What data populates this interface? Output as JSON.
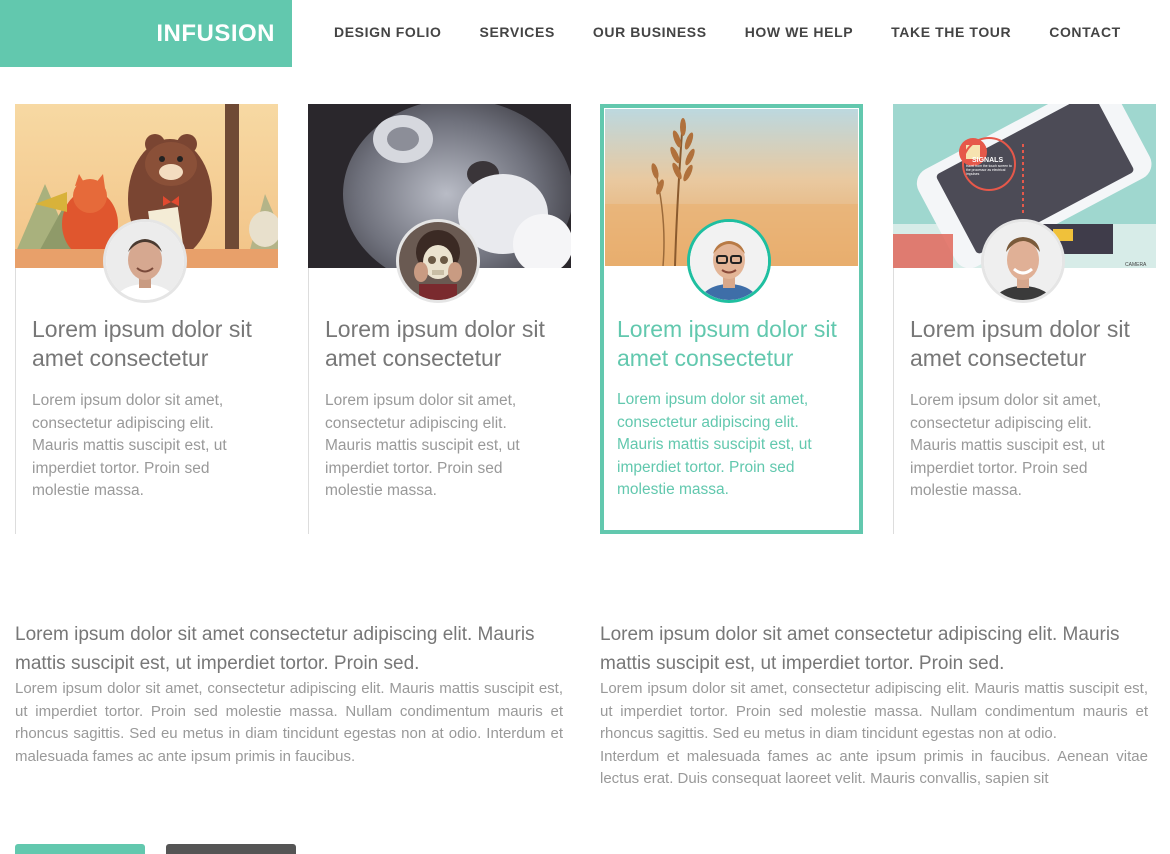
{
  "header": {
    "logo": "INFUSION",
    "nav": [
      "DESIGN FOLIO",
      "SERVICES",
      "OUR BUSINESS",
      "HOW WE HELP",
      "TAKE THE TOUR",
      "CONTACT"
    ]
  },
  "cards": [
    {
      "title": "Lorem ipsum dolor sit amet consectetur",
      "text": "Lorem ipsum dolor sit amet, consectetur adipiscing elit. Mauris mattis suscipit est, ut imperdiet tortor. Proin sed molestie massa."
    },
    {
      "title": "Lorem ipsum dolor sit amet consectetur",
      "text": "Lorem ipsum dolor sit amet, consectetur adipiscing elit. Mauris mattis suscipit est, ut imperdiet tortor. Proin sed molestie massa."
    },
    {
      "title": "Lorem ipsum dolor sit amet consectetur",
      "text": "Lorem ipsum dolor sit amet, consectetur adipiscing elit. Mauris mattis suscipit est, ut imperdiet tortor. Proin sed molestie massa.",
      "active": true
    },
    {
      "title": "Lorem ipsum dolor sit amet consectetur",
      "text": "Lorem ipsum dolor sit amet, consectetur adipiscing elit. Mauris mattis suscipit est, ut imperdiet tortor. Proin sed molestie massa."
    }
  ],
  "illustration_text": {
    "signals": "SIGNALS",
    "signals_desc": "travel from the touch screen to the processor as electrical impulses",
    "camera": "CAMERA"
  },
  "columns": [
    {
      "lead": "Lorem ipsum dolor sit amet consectetur adipiscing elit. Mauris mattis suscipit est, ut imperdiet tortor. Proin sed.",
      "p1": "Lorem ipsum dolor sit amet, consectetur adipiscing elit. Mauris mattis suscipit est, ut imperdiet tortor. Proin sed molestie massa. Nullam condimentum mauris et rhoncus sagittis. Sed eu metus in diam tincidunt egestas non at odio. Interdum et malesuada fames ac ante ipsum primis in faucibus."
    },
    {
      "lead": "Lorem ipsum dolor sit amet consectetur adipiscing elit. Mauris mattis suscipit est, ut imperdiet tortor. Proin sed.",
      "p1": "Lorem ipsum dolor sit amet, consectetur adipiscing elit. Mauris mattis suscipit est, ut imperdiet tortor. Proin sed molestie massa. Nullam condimentum mauris et rhoncus sagittis. Sed eu metus in diam tincidunt egestas non at odio.",
      "p2": "Interdum et malesuada fames ac ante ipsum primis in faucibus. Aenean vitae lectus erat. Duis consequat laoreet velit. Mauris convallis, sapien sit"
    }
  ],
  "colors": {
    "accent": "#62c8ae",
    "active_ring": "#1fbfa0",
    "dark_button": "#555555"
  }
}
